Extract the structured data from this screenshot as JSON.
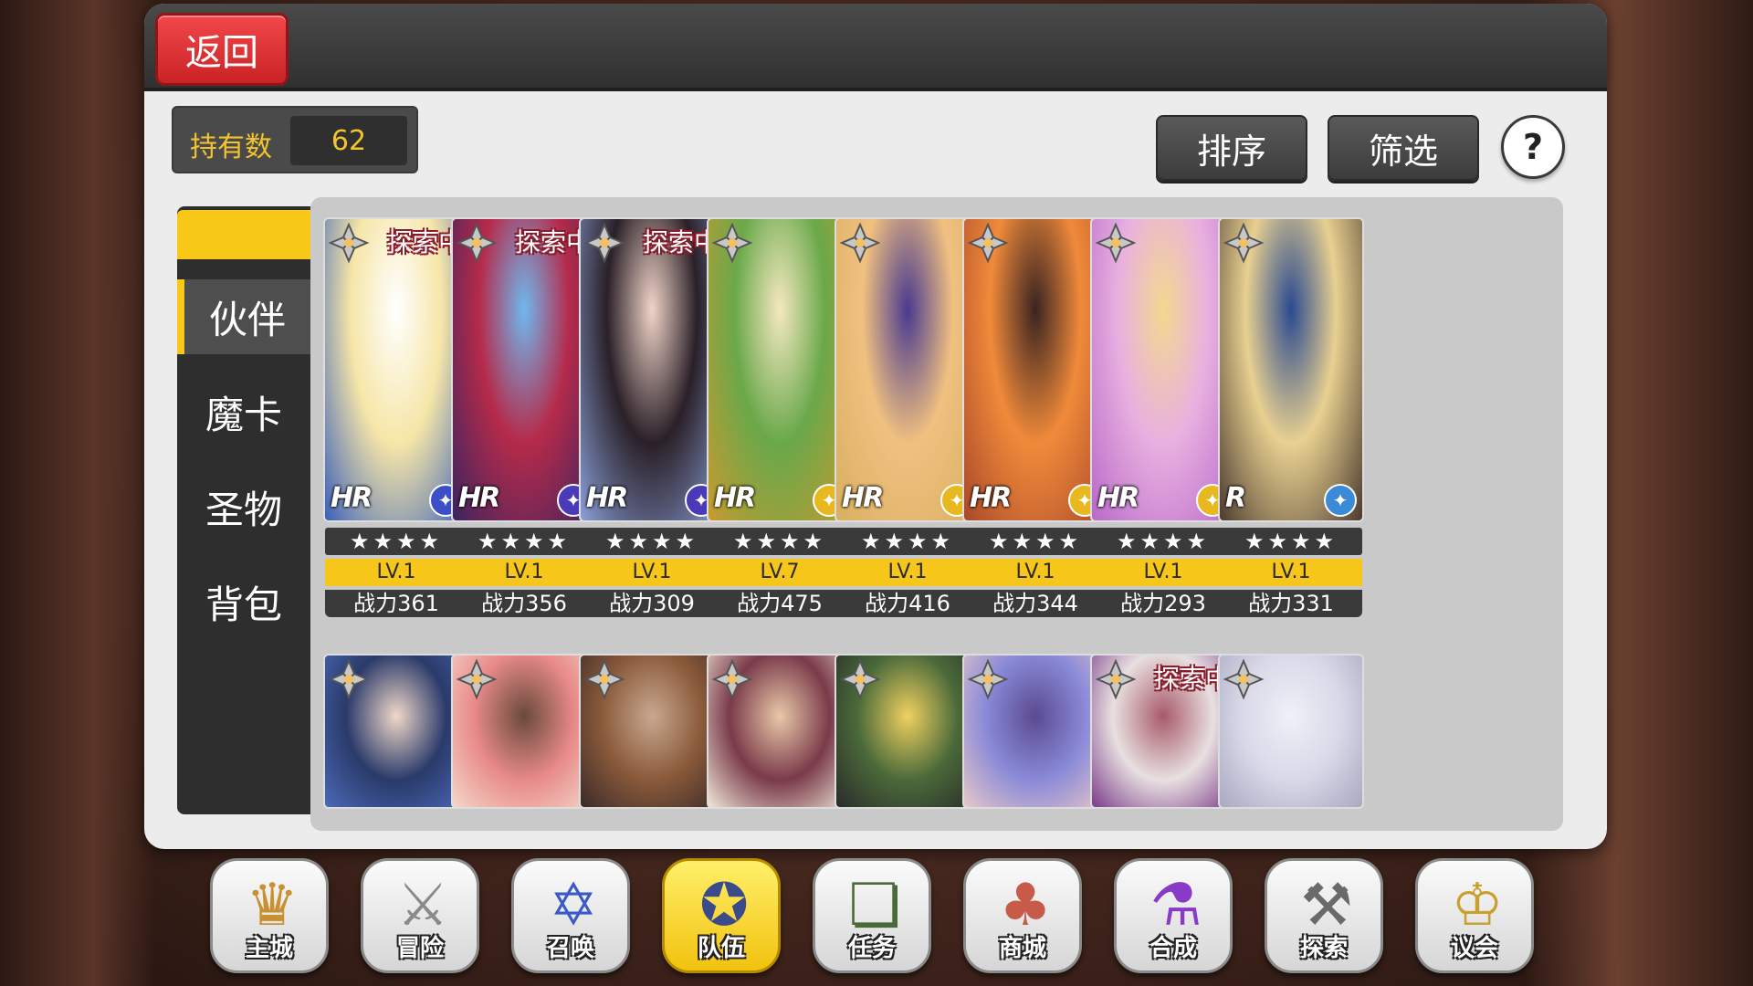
{
  "header": {
    "back_label": "返回"
  },
  "owned": {
    "label": "持有数",
    "value": "62"
  },
  "toolbar": {
    "sort_label": "排序",
    "filter_label": "筛选",
    "help_label": "?"
  },
  "side_menu": {
    "items": [
      {
        "label": "伙伴",
        "active": true
      },
      {
        "label": "魔卡",
        "active": false
      },
      {
        "label": "圣物",
        "active": false
      },
      {
        "label": "背包",
        "active": false
      }
    ]
  },
  "cards_row1": [
    {
      "status": "探索中",
      "rarity": "HR",
      "stars": "★★★★",
      "level": "LV.1",
      "power": "战力361",
      "palette": [
        "#f6e6a8",
        "#ffffff",
        "#3a5fb8"
      ],
      "class_color": "#3c4ec8",
      "class_icon": "sword-icon"
    },
    {
      "status": "探索中",
      "rarity": "HR",
      "stars": "★★★★",
      "level": "LV.1",
      "power": "战力356",
      "palette": [
        "#b52a4a",
        "#6fb8ee",
        "#3a2460"
      ],
      "class_color": "#4a3ab8",
      "class_icon": "shield-icon"
    },
    {
      "status": "探索中",
      "rarity": "HR",
      "stars": "★★★★",
      "level": "LV.1",
      "power": "战力309",
      "palette": [
        "#2a2028",
        "#f0d4c8",
        "#8aa0d8"
      ],
      "class_color": "#4a3ab8",
      "class_icon": "bow-icon"
    },
    {
      "status": "",
      "rarity": "HR",
      "stars": "★★★★",
      "level": "LV.7",
      "power": "战力475",
      "palette": [
        "#6aa84a",
        "#f4e8c0",
        "#c89a30"
      ],
      "class_color": "#e8b820",
      "class_icon": "shield-icon"
    },
    {
      "status": "",
      "rarity": "HR",
      "stars": "★★★★",
      "level": "LV.1",
      "power": "战力416",
      "palette": [
        "#f0c080",
        "#4a3a90",
        "#d8b060"
      ],
      "class_color": "#e8b820",
      "class_icon": "sword-icon"
    },
    {
      "status": "",
      "rarity": "HR",
      "stars": "★★★★",
      "level": "LV.1",
      "power": "战力344",
      "palette": [
        "#f08a3a",
        "#3a2420",
        "#a8482a"
      ],
      "class_color": "#e8b820",
      "class_icon": "axe-icon"
    },
    {
      "status": "",
      "rarity": "HR",
      "stars": "★★★★",
      "level": "LV.1",
      "power": "战力293",
      "palette": [
        "#e8b0e0",
        "#f4d890",
        "#b868c8"
      ],
      "class_color": "#e8b820",
      "class_icon": "cross-icon"
    },
    {
      "status": "",
      "rarity": "R",
      "stars": "★★★★",
      "level": "LV.1",
      "power": "战力331",
      "palette": [
        "#e8d090",
        "#2a4a90",
        "#4a3a30"
      ],
      "class_color": "#3a8ad8",
      "class_icon": "sword-icon"
    }
  ],
  "cards_row2": [
    {
      "status": "",
      "palette": [
        "#2a3a6a",
        "#f0d8c8",
        "#4a6ab8"
      ]
    },
    {
      "status": "",
      "palette": [
        "#e88a8a",
        "#6a4a3a",
        "#f4d8c8"
      ]
    },
    {
      "status": "",
      "palette": [
        "#8a5a3a",
        "#c8a890",
        "#3a2a2a"
      ]
    },
    {
      "status": "",
      "palette": [
        "#7a3a4a",
        "#e8c8a8",
        "#f0e8d8"
      ]
    },
    {
      "status": "",
      "palette": [
        "#4a6a3a",
        "#f0d060",
        "#2a2a2a"
      ]
    },
    {
      "status": "",
      "palette": [
        "#8a8ad8",
        "#5a4a90",
        "#e8c8c8"
      ]
    },
    {
      "status": "探索中",
      "palette": [
        "#e8e0e0",
        "#a85a6a",
        "#7a3a8a"
      ]
    },
    {
      "status": "",
      "palette": [
        "#d8d8e8",
        "#f0f0f8",
        "#a8a8c0"
      ]
    }
  ],
  "bottom_nav": [
    {
      "label": "主城",
      "icon": "castle-crown-icon",
      "active": false,
      "color": "#c89030"
    },
    {
      "label": "冒险",
      "icon": "crossed-swords-icon",
      "active": false,
      "color": "#8a8a8a"
    },
    {
      "label": "召唤",
      "icon": "summon-card-icon",
      "active": false,
      "color": "#3a5ac8"
    },
    {
      "label": "队伍",
      "icon": "winged-emblem-icon",
      "active": true,
      "color": "#3a4a8a"
    },
    {
      "label": "任务",
      "icon": "quest-book-icon",
      "active": false,
      "color": "#4a6a3a"
    },
    {
      "label": "商城",
      "icon": "shop-tree-icon",
      "active": false,
      "color": "#c85a4a"
    },
    {
      "label": "合成",
      "icon": "potion-flask-icon",
      "active": false,
      "color": "#8a3ac8"
    },
    {
      "label": "探索",
      "icon": "shovel-icon",
      "active": false,
      "color": "#6a6a6a"
    },
    {
      "label": "议会",
      "icon": "council-crest-icon",
      "active": false,
      "color": "#c8a030"
    }
  ]
}
